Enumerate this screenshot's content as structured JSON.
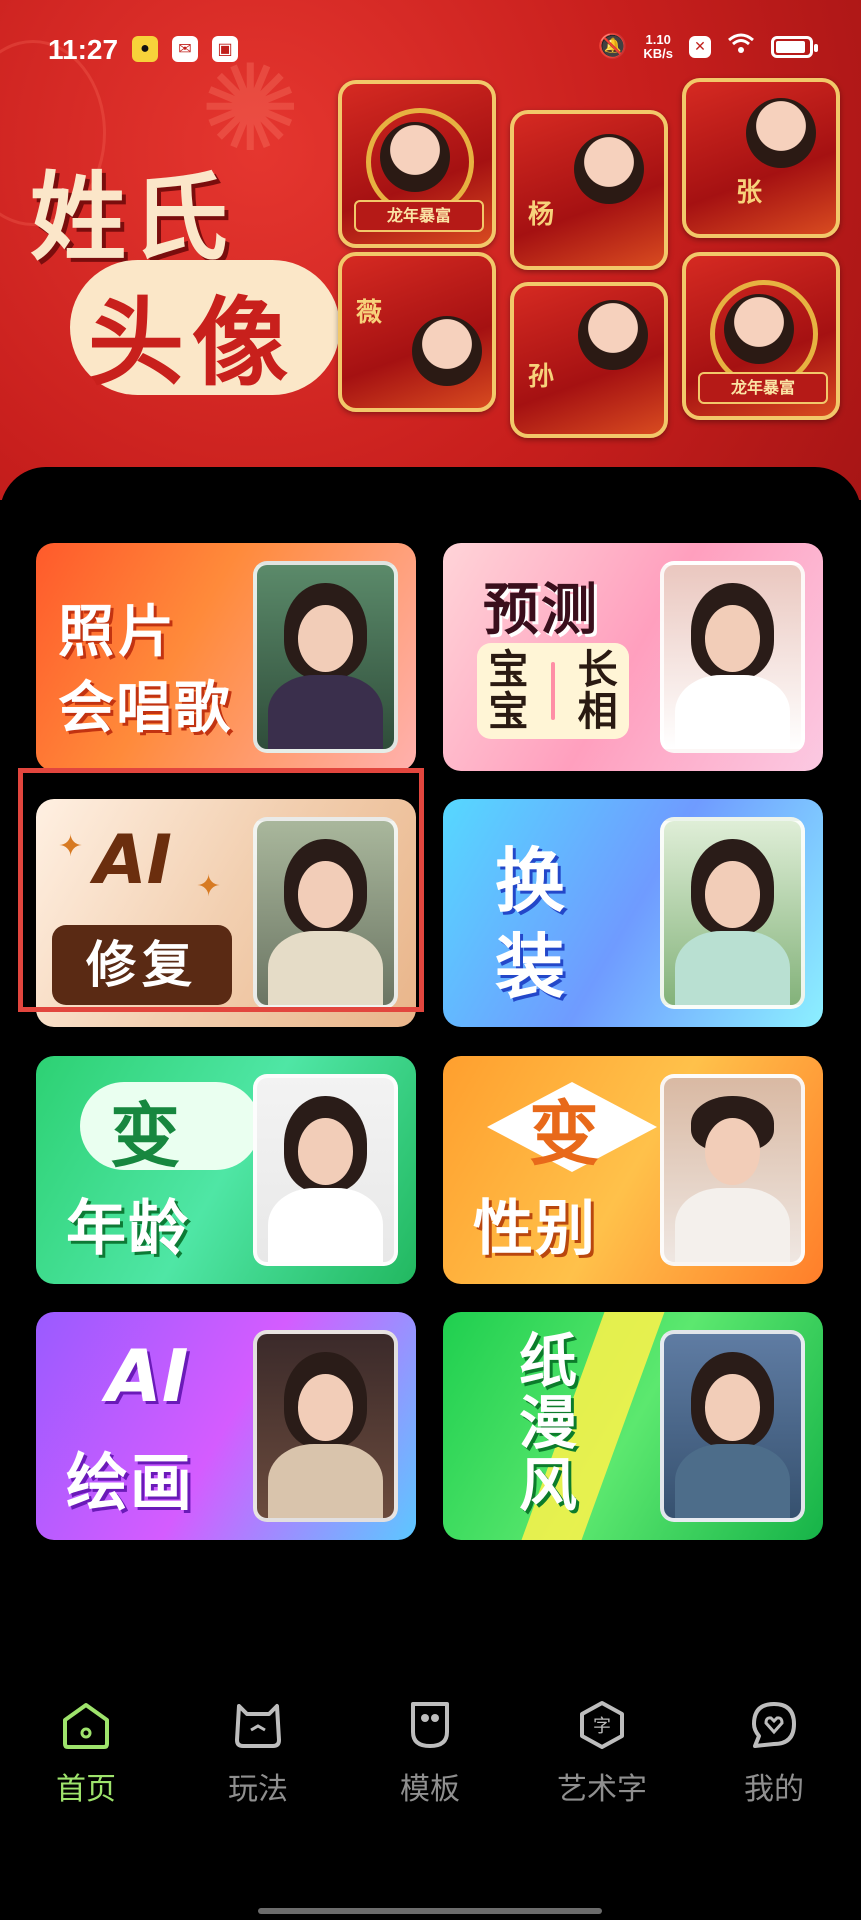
{
  "status_bar": {
    "time": "11:27",
    "network_speed_value": "1.10",
    "network_speed_unit": "KB/s",
    "battery_level": 0.9
  },
  "banner": {
    "title_line1": "姓氏",
    "title_line2": "头像",
    "thumbnails": [
      {
        "ribbon": "龙年暴富"
      },
      {
        "char": "杨"
      },
      {
        "char": "张"
      },
      {
        "char": "薇"
      },
      {
        "char": "孙"
      },
      {
        "ribbon": "龙年暴富"
      }
    ]
  },
  "features": {
    "sing": {
      "line1": "照片",
      "line2": "会唱歌"
    },
    "predict": {
      "line1": "预测",
      "box_left": "宝宝",
      "box_right": "长相"
    },
    "repair": {
      "ai": "AI",
      "tag": "修复"
    },
    "outfit": {
      "line1": "换",
      "line2": "装"
    },
    "age": {
      "line1": "变",
      "line2": "年龄"
    },
    "gender": {
      "line1": "变",
      "line2": "性别"
    },
    "draw": {
      "line1": "AI",
      "line2": "绘画"
    },
    "comic": {
      "line1": "纸漫风"
    }
  },
  "tabbar": {
    "items": [
      {
        "label": "首页",
        "icon": "home-icon",
        "active": true
      },
      {
        "label": "玩法",
        "icon": "play-icon",
        "active": false
      },
      {
        "label": "模板",
        "icon": "template-icon",
        "active": false
      },
      {
        "label": "艺术字",
        "icon": "art-text-icon",
        "active": false
      },
      {
        "label": "我的",
        "icon": "profile-icon",
        "active": false
      }
    ],
    "active_color": "#9ee36c",
    "inactive_color": "#8f8f8f"
  }
}
